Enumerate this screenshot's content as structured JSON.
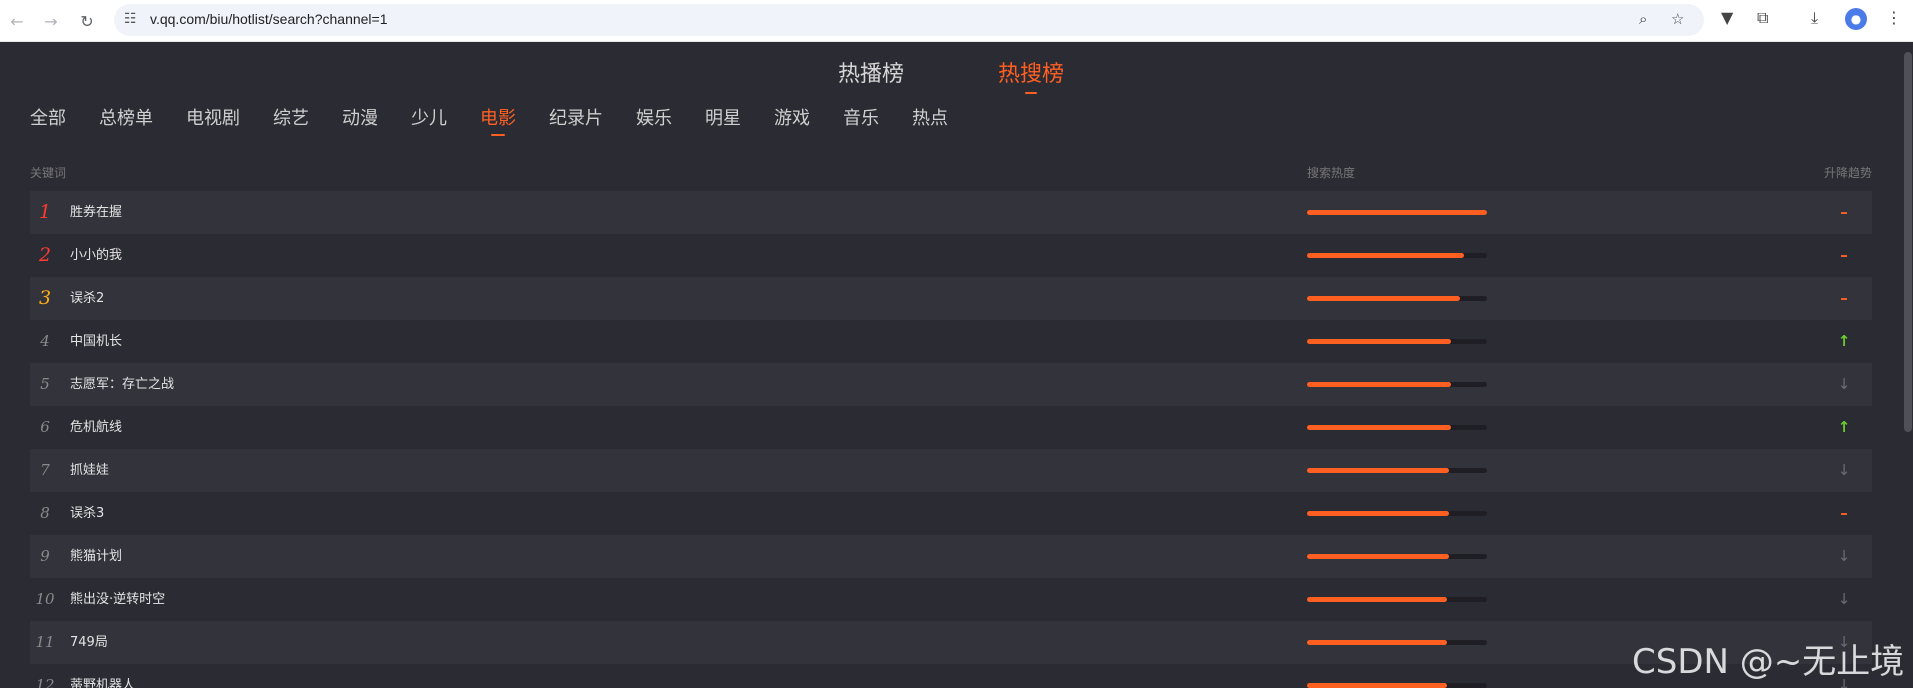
{
  "browser": {
    "url": "v.qq.com/biu/hotlist/search?channel=1"
  },
  "main_tabs": [
    {
      "label": "热播榜",
      "active": false
    },
    {
      "label": "热搜榜",
      "active": true
    }
  ],
  "sub_tabs": [
    {
      "label": "全部",
      "active": false
    },
    {
      "label": "总榜单",
      "active": false
    },
    {
      "label": "电视剧",
      "active": false
    },
    {
      "label": "综艺",
      "active": false
    },
    {
      "label": "动漫",
      "active": false
    },
    {
      "label": "少儿",
      "active": false
    },
    {
      "label": "电影",
      "active": true
    },
    {
      "label": "纪录片",
      "active": false
    },
    {
      "label": "娱乐",
      "active": false
    },
    {
      "label": "明星",
      "active": false
    },
    {
      "label": "游戏",
      "active": false
    },
    {
      "label": "音乐",
      "active": false
    },
    {
      "label": "热点",
      "active": false
    }
  ],
  "table": {
    "col_keyword": "关键词",
    "col_heat": "搜索热度",
    "col_trend": "升降趋势",
    "rows": [
      {
        "rank": "1",
        "keyword": "胜券在握",
        "heat": 1.0,
        "trend": "same"
      },
      {
        "rank": "2",
        "keyword": "小小的我",
        "heat": 0.87,
        "trend": "same"
      },
      {
        "rank": "3",
        "keyword": "误杀2",
        "heat": 0.85,
        "trend": "same"
      },
      {
        "rank": "4",
        "keyword": "中国机长",
        "heat": 0.8,
        "trend": "up"
      },
      {
        "rank": "5",
        "keyword": "志愿军：存亡之战",
        "heat": 0.8,
        "trend": "down"
      },
      {
        "rank": "6",
        "keyword": "危机航线",
        "heat": 0.8,
        "trend": "up"
      },
      {
        "rank": "7",
        "keyword": "抓娃娃",
        "heat": 0.79,
        "trend": "down"
      },
      {
        "rank": "8",
        "keyword": "误杀3",
        "heat": 0.79,
        "trend": "same"
      },
      {
        "rank": "9",
        "keyword": "熊猫计划",
        "heat": 0.79,
        "trend": "down"
      },
      {
        "rank": "10",
        "keyword": "熊出没·逆转时空",
        "heat": 0.78,
        "trend": "down"
      },
      {
        "rank": "11",
        "keyword": "749局",
        "heat": 0.78,
        "trend": "down"
      },
      {
        "rank": "12",
        "keyword": "蒂野机器人",
        "heat": 0.78,
        "trend": "down"
      }
    ]
  },
  "trend_icons": {
    "same": "–",
    "up": "↑",
    "down": "↓"
  },
  "watermark": "CSDN @~无止境",
  "colors": {
    "accent": "#ff6022",
    "rank1": "#ff3b30",
    "rank3": "#ffae18",
    "up": "#6acf2b"
  }
}
